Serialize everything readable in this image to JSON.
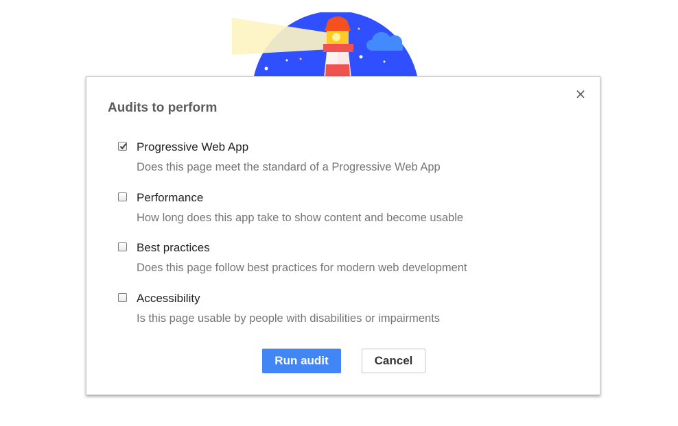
{
  "dialog": {
    "title": "Audits to perform",
    "close_symbol": "×",
    "audits": [
      {
        "name": "Progressive Web App",
        "description": "Does this page meet the standard of a Progressive Web App",
        "checked": true
      },
      {
        "name": "Performance",
        "description": "How long does this app take to show content and become usable",
        "checked": false
      },
      {
        "name": "Best practices",
        "description": "Does this page follow best practices for modern web development",
        "checked": false
      },
      {
        "name": "Accessibility",
        "description": "Is this page usable by people with disabilities or impairments",
        "checked": false
      }
    ],
    "primary_button": "Run audit",
    "secondary_button": "Cancel"
  },
  "illustration": {
    "icon": "lighthouse-logo-icon",
    "sky_color": "#304ffe",
    "beam_color": "#fdf3c3",
    "tower_color": "#ef5350",
    "cloud_color": "#448aff"
  },
  "colors": {
    "accent": "#4285f4"
  }
}
